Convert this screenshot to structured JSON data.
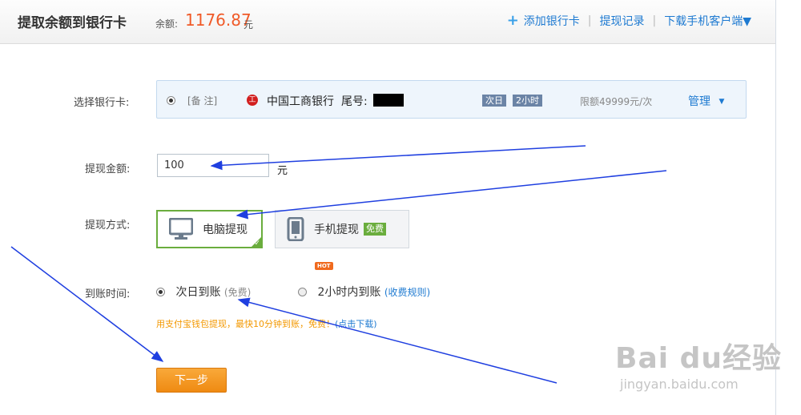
{
  "header": {
    "title": "提取余额到银行卡",
    "balance_label": "余额:",
    "balance_value": "1176.87",
    "balance_unit": "元",
    "links": {
      "add_card": "添加银行卡",
      "history": "提现记录",
      "download": "下载手机客户端▼"
    }
  },
  "form": {
    "card_label": "选择银行卡:",
    "card": {
      "note": "[备 注]",
      "bank_name": "中国工商银行",
      "tail_label": "尾号:",
      "tag_next_day": "次日",
      "tag_two_hours": "2小时",
      "limit": "限额49999元/次",
      "manage": "管理"
    },
    "amount_label": "提现金额:",
    "amount_value": "100",
    "amount_unit": "元",
    "method_label": "提现方式:",
    "methods": {
      "pc": "电脑提现",
      "mobile": "手机提现",
      "mobile_badge": "免费"
    },
    "time_label": "到账时间:",
    "time_options": {
      "hot_badge": "HOT",
      "next_day": "次日到账",
      "next_day_sub": "(免费)",
      "two_hours": "2小时内到账",
      "rules": "(收费规则)"
    },
    "promo_text": "用支付宝钱包提现，最快10分钟到账，免费！",
    "promo_link": "(点击下载)",
    "next_button": "下一步"
  },
  "watermark": {
    "brand": "Bai du经验",
    "url": "jingyan.baidu.com"
  },
  "colors": {
    "accent_orange": "#f05a28",
    "link_blue": "#1e7ad1",
    "selected_green": "#6aad3d",
    "button_orange": "#f39800",
    "annotation_arrow": "#1f3fe0"
  },
  "icons": {
    "plus": "plus-icon",
    "bank": "icbc-logo-icon",
    "pc": "monitor-icon",
    "mobile": "phone-icon",
    "dropdown": "caret-down-icon",
    "check": "check-icon"
  }
}
